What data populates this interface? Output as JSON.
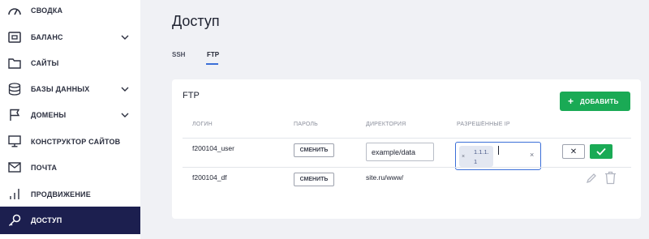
{
  "sidebar": {
    "items": [
      {
        "label": "СВОДКА",
        "icon": "gauge-icon"
      },
      {
        "label": "БАЛАНС",
        "icon": "wallet-icon"
      },
      {
        "label": "САЙТЫ",
        "icon": "folder-icon"
      },
      {
        "label": "БАЗЫ ДАННЫХ",
        "icon": "database-icon"
      },
      {
        "label": "ДОМЕНЫ",
        "icon": "flag-icon"
      },
      {
        "label": "КОНСТРУКТОР САЙТОВ",
        "icon": "monitor-icon"
      },
      {
        "label": "ПОЧТА",
        "icon": "mail-icon"
      },
      {
        "label": "ПРОДВИЖЕНИЕ",
        "icon": "bar-chart-icon"
      },
      {
        "label": "ДОСТУП",
        "icon": "key-icon"
      }
    ],
    "active": "ДОСТУП"
  },
  "main": {
    "title": "Доступ",
    "tabs": [
      {
        "label": "SSH",
        "active": false
      },
      {
        "label": "FTP",
        "active": true
      }
    ],
    "card": {
      "title": "FTP",
      "add_button": "ДОБАВИТЬ",
      "columns": [
        "ЛОГИН",
        "ПАРОЛЬ",
        "ДИРЕКТОРИЯ",
        "РАЗРЕШЁННЫЕ IP"
      ],
      "rows": [
        {
          "login": "f200104_user",
          "password_button": "СМЕНИТЬ",
          "directory_value": "example/data",
          "allowed_ip": "1.1.1.1",
          "editing": true
        },
        {
          "login": "f200104_df",
          "password_button": "СМЕНИТЬ",
          "directory": "site.ru/www/",
          "allowed_ip": "",
          "editing": false
        }
      ]
    }
  },
  "colors": {
    "accent": "#3b6fd8",
    "sidebar_active": "#1c1f4f",
    "success": "#1aaa55",
    "background": "#f0f1f5"
  }
}
